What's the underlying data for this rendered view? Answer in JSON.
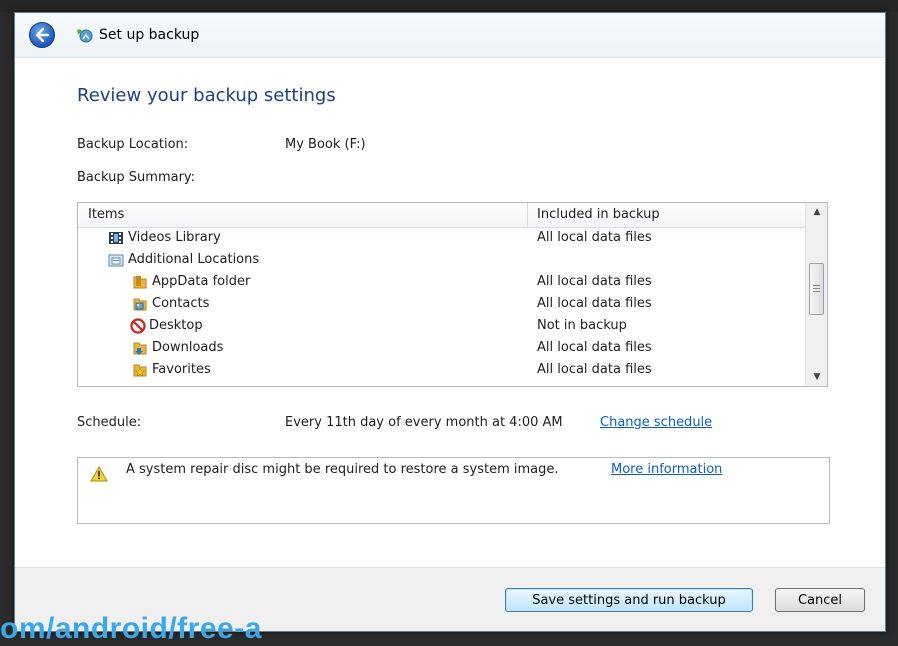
{
  "window": {
    "title": "Set up backup"
  },
  "page": {
    "heading": "Review your backup settings",
    "backup_location_label": "Backup Location:",
    "backup_location_value": "My Book (F:)",
    "backup_summary_label": "Backup Summary:"
  },
  "table": {
    "headers": {
      "items": "Items",
      "included": "Included in backup"
    },
    "rows": [
      {
        "name": "Videos Library",
        "value": "All local data files",
        "icon": "videos-library-icon"
      },
      {
        "name": "Additional Locations",
        "value": "",
        "icon": "additional-locations-icon"
      },
      {
        "name": "AppData folder",
        "value": "All local data files",
        "icon": "folder-icon"
      },
      {
        "name": "Contacts",
        "value": "All local data files",
        "icon": "contacts-icon"
      },
      {
        "name": "Desktop",
        "value": "Not in backup",
        "icon": "not-included-icon"
      },
      {
        "name": "Downloads",
        "value": "All local data files",
        "icon": "downloads-icon"
      },
      {
        "name": "Favorites",
        "value": "All local data files",
        "icon": "favorites-icon"
      }
    ]
  },
  "schedule": {
    "label": "Schedule:",
    "value": "Every 11th day of every month at 4:00 AM",
    "change_link": "Change schedule"
  },
  "notice": {
    "text": "A system repair disc might be required to restore a system image.",
    "link": "More information"
  },
  "buttons": {
    "save": "Save settings and run backup",
    "cancel": "Cancel"
  },
  "watermark": "om/android/free-a",
  "colors": {
    "heading": "#1a3f8c",
    "link": "#0b5cd6",
    "watermark": "#3ba8e8"
  }
}
